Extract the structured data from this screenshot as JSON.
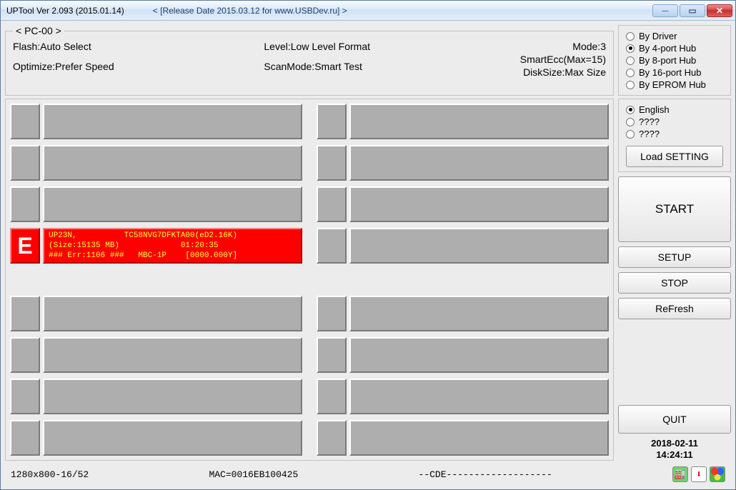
{
  "titlebar": {
    "title": "UPTool Ver 2.093 (2015.01.14)",
    "subtitle": "< [Release Date 2015.03.12 for www.USBDev.ru] >"
  },
  "info": {
    "legend": "< PC-00 >",
    "flash_label": "Flash:",
    "flash_value": "Auto Select",
    "optimize_label": "Optimize:",
    "optimize_value": "Prefer Speed",
    "level_label": "Level:",
    "level_value": "Low Level Format",
    "scanmode_label": "ScanMode:",
    "scanmode_value": "Smart Test",
    "mode_label": "Mode:",
    "mode_value": "3",
    "smartecc_label": "SmartEcc(Max=15)",
    "disksize_label": "DiskSize:",
    "disksize_value": "Max Size"
  },
  "hub": {
    "options": [
      "By Driver",
      "By 4-port Hub",
      "By 8-port Hub",
      "By 16-port Hub",
      "By EPROM Hub"
    ],
    "selected": 1
  },
  "lang": {
    "options": [
      "English",
      "????",
      "????"
    ],
    "selected": 0,
    "load_btn": "Load SETTING"
  },
  "slots": {
    "top": [
      {
        "tag": "",
        "text": "",
        "err": false
      },
      {
        "tag": "",
        "text": "",
        "err": false
      },
      {
        "tag": "",
        "text": "",
        "err": false
      },
      {
        "tag": "",
        "text": "",
        "err": false
      },
      {
        "tag": "",
        "text": "",
        "err": false
      },
      {
        "tag": "",
        "text": "",
        "err": false
      },
      {
        "tag": "E",
        "text": "UP23N,          TC58NVG7DFKTA00(eD2.16K)\n(Size:15135 MB)             01:20:35\n### Err:1106 ###   MBC-1P    [0000.000Y]",
        "err": true
      },
      {
        "tag": "",
        "text": "",
        "err": false
      }
    ],
    "bottom": [
      {
        "tag": "",
        "text": "",
        "err": false
      },
      {
        "tag": "",
        "text": "",
        "err": false
      },
      {
        "tag": "",
        "text": "",
        "err": false
      },
      {
        "tag": "",
        "text": "",
        "err": false
      },
      {
        "tag": "",
        "text": "",
        "err": false
      },
      {
        "tag": "",
        "text": "",
        "err": false
      },
      {
        "tag": "",
        "text": "",
        "err": false
      },
      {
        "tag": "",
        "text": "",
        "err": false
      }
    ]
  },
  "buttons": {
    "start": "START",
    "setup": "SETUP",
    "stop": "STOP",
    "refresh": "ReFresh",
    "quit": "QUIT"
  },
  "datetime": {
    "date": "2018-02-11",
    "time": "14:24:11"
  },
  "status": {
    "res": "1280x800-16/52",
    "mac": "MAC=0016EB100425",
    "cde": "--CDE-------------------"
  }
}
